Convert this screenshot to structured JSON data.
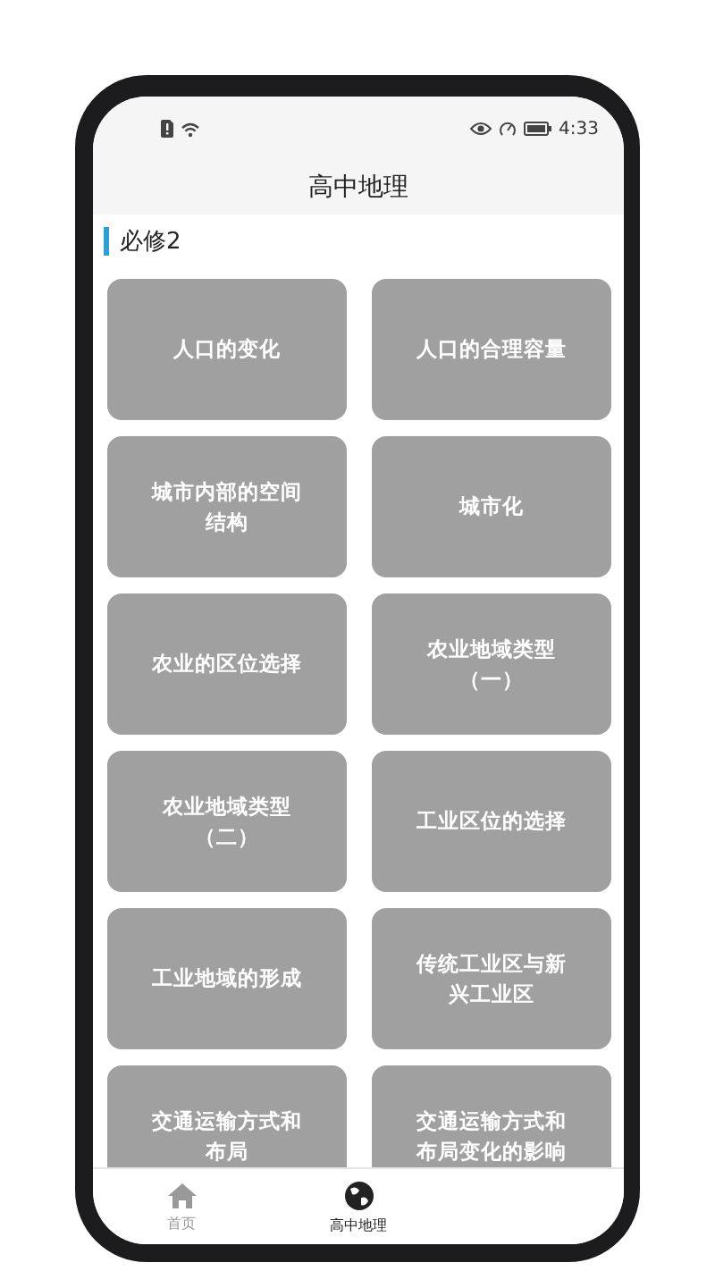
{
  "status_bar": {
    "time": "4:33"
  },
  "header": {
    "title": "高中地理"
  },
  "section": {
    "title": "必修2"
  },
  "topic_rows": [
    {
      "cards": [
        {
          "label": "人口的变化"
        },
        {
          "label": "人口的合理容量"
        }
      ]
    },
    {
      "cards": [
        {
          "label": "城市内部的空间结构"
        },
        {
          "label": "城市化"
        }
      ]
    },
    {
      "cards": [
        {
          "label": "农业的区位选择"
        },
        {
          "label": "农业地域类型（一）"
        }
      ]
    },
    {
      "cards": [
        {
          "label": "农业地域类型（二）"
        },
        {
          "label": "工业区位的选择"
        }
      ]
    },
    {
      "cards": [
        {
          "label": "工业地域的形成"
        },
        {
          "label": "传统工业区与新兴工业区"
        }
      ]
    },
    {
      "cards": [
        {
          "label": "交通运输方式和布局"
        },
        {
          "label": "交通运输方式和布局变化的影响"
        }
      ]
    }
  ],
  "tabs": [
    {
      "label": "首页",
      "kind": "home",
      "selected": false
    },
    {
      "label": "高中地理",
      "kind": "globe",
      "selected": true
    }
  ]
}
